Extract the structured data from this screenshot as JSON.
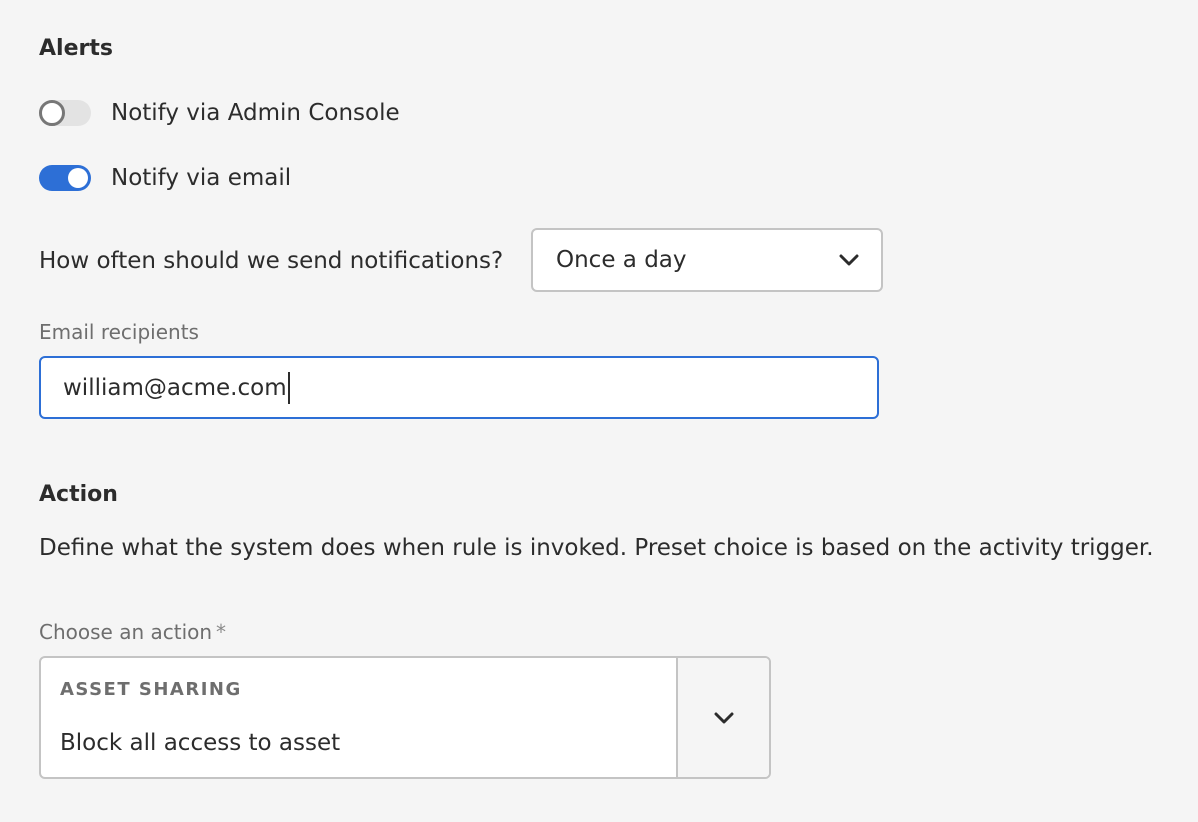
{
  "alerts": {
    "heading": "Alerts",
    "admin_console_toggle": {
      "label": "Notify via Admin Console",
      "checked": false
    },
    "email_toggle": {
      "label": "Notify via email",
      "checked": true
    },
    "frequency": {
      "question": "How often should we send notifications?",
      "selected": "Once a day",
      "icon": "chevron-down-icon"
    },
    "email_recipients": {
      "label": "Email recipients",
      "value": "william@acme.com"
    }
  },
  "action": {
    "heading": "Action",
    "description": "Define what the system does when rule is invoked. Preset choice is based on the activity trigger.",
    "choose_label": "Choose an action",
    "required_marker": "*",
    "picker": {
      "category": "ASSET SHARING",
      "selected": "Block all access to asset",
      "icon": "chevron-down-icon"
    }
  },
  "colors": {
    "accent": "#2d6fd6",
    "background": "#f5f5f5",
    "text": "#2c2c2c",
    "muted_text": "#6e6e6e",
    "border": "#c4c4c4"
  }
}
